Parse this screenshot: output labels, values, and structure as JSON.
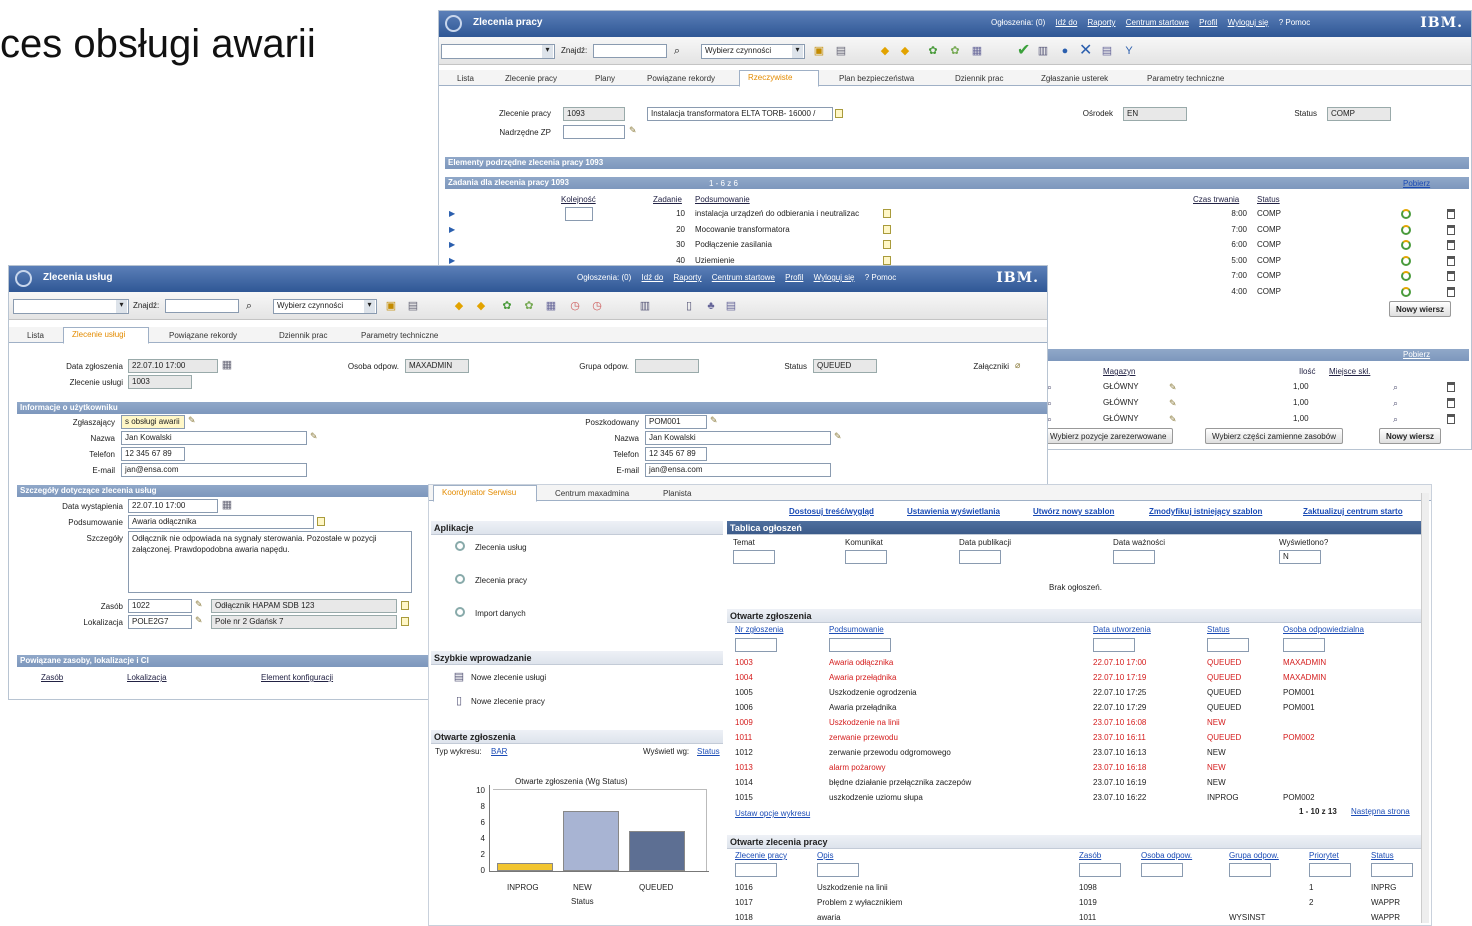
{
  "slide": {
    "title": "ces obsługi awarii"
  },
  "colors": {
    "titlebar": "#3a629f",
    "section": "#8aa3c6",
    "accent": "#e38b00",
    "red": "#d41c1c",
    "link": "#1a4bb5"
  },
  "back": {
    "app_title": "Zlecenia pracy",
    "nav": [
      "Ogłoszenia: (0)",
      "Idź do",
      "Raporty",
      "Centrum startowe",
      "Profil",
      "Wyloguj się",
      "? Pomoc"
    ],
    "logo": "IBM.",
    "find_label": "Znajdź:",
    "action_select": "Wybierz czynności",
    "tabs": [
      "Lista",
      "Zlecenie pracy",
      "Plany",
      "Powiązane rekordy",
      "Rzeczywiste",
      "Plan bezpieczeństwa",
      "Dziennik prac",
      "Zgłaszanie usterek",
      "Parametry techniczne"
    ],
    "active_tab": "Rzeczywiste",
    "wo_label": "Zlecenie pracy",
    "wo_value": "1093",
    "wo_desc": "Instalacja transformatora ELTA TORB- 16000 /",
    "parent_label": "Nadrzędne ZP",
    "site_label": "Ośrodek",
    "site_value": "EN",
    "status_label": "Status",
    "status_value": "COMP",
    "child_section": "Elementy podrzędne zlecenia pracy 1093",
    "tasks_section": "Zadania dla zlecenia pracy 1093",
    "tasks_pager": "1 - 6 z 6",
    "tasks_filter": "Filtr",
    "download": "Pobierz",
    "task_headers": [
      "Kolejność",
      "Zadanie",
      "Podsumowanie",
      "Czas trwania",
      "Status"
    ],
    "tasks": [
      {
        "task": "10",
        "summary": "instalacja urządzeń do odbierania i neutralizac",
        "duration": "8:00",
        "status": "COMP"
      },
      {
        "task": "20",
        "summary": "Mocowanie transformatora",
        "duration": "7:00",
        "status": "COMP"
      },
      {
        "task": "30",
        "summary": "Podłączenie zasilania",
        "duration": "6:00",
        "status": "COMP"
      },
      {
        "task": "40",
        "summary": "Uziemienie",
        "duration": "5:00",
        "status": "COMP"
      },
      {
        "task": "",
        "summary": "",
        "duration": "7:00",
        "status": "COMP"
      },
      {
        "task": "",
        "summary": "",
        "duration": "4:00",
        "status": "COMP"
      }
    ],
    "new_row": "Nowy wiersz",
    "materials_headers": [
      "Magazyn",
      "Ilość",
      "Miejsce skł."
    ],
    "materials": [
      {
        "store": "GŁÓWNY",
        "qty": "1,00"
      },
      {
        "store": "GŁÓWNY",
        "qty": "1,00"
      },
      {
        "store": "GŁÓWNY",
        "qty": "1,00"
      }
    ],
    "btn_reserved": "Wybierz pozycje zarezerwowane",
    "btn_spare": "Wybierz części zamienne zasobów",
    "btn_new_row": "Nowy wiersz"
  },
  "front": {
    "app_title": "Zlecenia usług",
    "nav": [
      "Ogłoszenia: (0)",
      "Idź do",
      "Raporty",
      "Centrum startowe",
      "Profil",
      "Wyloguj się",
      "? Pomoc"
    ],
    "logo": "IBM.",
    "find_label": "Znajdź:",
    "action_select": "Wybierz czynności",
    "tabs": [
      "Lista",
      "Zlecenie usługi",
      "Powiązane rekordy",
      "Dziennik prac",
      "Parametry techniczne"
    ],
    "active_tab": "Zlecenie usługi",
    "report_date_label": "Data zgłoszenia",
    "report_date": "22.07.10 17:00",
    "sr_label": "Zlecenie usługi",
    "sr_value": "1003",
    "owner_label": "Osoba odpow.",
    "owner_value": "MAXADMIN",
    "group_label": "Grupa odpow.",
    "status_label": "Status",
    "status_value": "QUEUED",
    "attach_label": "Załączniki",
    "user_section": "Informacje o użytkowniku",
    "reporter_label": "Zgłaszający",
    "reporter_value": "s obsługi awarii",
    "name_label": "Nazwa",
    "name_value": "Jan Kowalski",
    "phone_label": "Telefon",
    "phone_value": "12 345 67 89",
    "email_label": "E-mail",
    "email_value": "jan@ensa.com",
    "affected_label": "Poszkodowany",
    "affected_value": "POM001",
    "a_name_value": "Jan Kowalski",
    "a_phone_value": "12 345 67 89",
    "a_email_value": "jan@ensa.com",
    "details_section": "Szczegóły dotyczące zlecenia usług",
    "occ_label": "Data wystąpienia",
    "occ_value": "22.07.10 17:00",
    "summary_label": "Podsumowanie",
    "summary_value": "Awaria odłącznika",
    "details_label": "Szczegóły",
    "details_value": "Odłącznik nie odpowiada na sygnały sterowania. Pozostałe w pozycji załączonej. Prawdopodobna awaria napędu.",
    "asset_label": "Zasób",
    "asset_value": "1022",
    "asset_desc": "Odłącznik HAPAM SDB 123",
    "loc_label": "Lokalizacja",
    "loc_value": "POLE2G7",
    "loc_desc": "Pole nr 2 Gdańsk 7",
    "related_section": "Powiązane zasoby, lokalizacje i CI",
    "related_headers": [
      "Zasób",
      "Lokalizacja",
      "Element konfiguracji"
    ]
  },
  "start": {
    "tabs": [
      "Koordynator Serwisu",
      "Centrum maxadmina",
      "Planista"
    ],
    "active_tab": "Koordynator Serwisu",
    "links": [
      "Dostosuj treść/wygląd",
      "Ustawienia wyświetlania",
      "Utwórz nowy szablon",
      "Zmodyfikuj istniejący szablon",
      "Zaktualizuj centrum starto"
    ],
    "apps_title": "Aplikacje",
    "apps": [
      "Zlecenia usług",
      "Zlecenia pracy",
      "Import danych"
    ],
    "quick_title": "Szybkie wprowadzanie",
    "quick": [
      "Nowe zlecenie usługi",
      "Nowe zlecenie pracy"
    ],
    "board_title": "Tablica ogłoszeń",
    "board_headers": [
      "Temat",
      "Komunikat",
      "Data publikacji",
      "Data ważności",
      "Wyświetlono?"
    ],
    "board_filter_value": "N",
    "board_empty": "Brak ogłoszeń.",
    "open_title": "Otwarte zgłoszenia",
    "open_headers": [
      "Nr zgłoszenia",
      "Podsumowanie",
      "Data utworzenia",
      "Status",
      "Osoba odpowiedzialna"
    ],
    "open_rows": [
      {
        "id": "1003",
        "summary": "Awaria odłącznika",
        "date": "22.07.10 17:00",
        "status": "QUEUED",
        "owner": "MAXADMIN",
        "red": true
      },
      {
        "id": "1004",
        "summary": "Awaria przełądnika",
        "date": "22.07.10 17:19",
        "status": "QUEUED",
        "owner": "MAXADMIN",
        "red": true
      },
      {
        "id": "1005",
        "summary": "Uszkodzenie ogrodzenia",
        "date": "22.07.10 17:25",
        "status": "QUEUED",
        "owner": "POM001",
        "red": false
      },
      {
        "id": "1006",
        "summary": "Awaria przełądnika",
        "date": "22.07.10 17:29",
        "status": "QUEUED",
        "owner": "POM001",
        "red": false
      },
      {
        "id": "1009",
        "summary": "Uszkodzenie na linii",
        "date": "23.07.10 16:08",
        "status": "NEW",
        "owner": "",
        "red": true
      },
      {
        "id": "1011",
        "summary": "zerwanie przewodu",
        "date": "23.07.10 16:11",
        "status": "QUEUED",
        "owner": "POM002",
        "red": true
      },
      {
        "id": "1012",
        "summary": "zerwanie przewodu odgromowego",
        "date": "23.07.10 16:13",
        "status": "NEW",
        "owner": "",
        "red": false
      },
      {
        "id": "1013",
        "summary": "alarm pożarowy",
        "date": "23.07.10 16:18",
        "status": "NEW",
        "owner": "",
        "red": true
      },
      {
        "id": "1014",
        "summary": "błędne działanie przełącznika zaczepów",
        "date": "23.07.10 16:19",
        "status": "NEW",
        "owner": "",
        "red": false
      },
      {
        "id": "1015",
        "summary": "uszkodzenie uziomu słupa",
        "date": "23.07.10 16:22",
        "status": "INPROG",
        "owner": "POM002",
        "red": false
      }
    ],
    "chart_options": "Ustaw opcje wykresu",
    "pager": "1 - 10 z 13",
    "next_page": "Następna strona",
    "chart_portlet_title": "Otwarte zgłoszenia",
    "chart_type_label": "Typ wykresu:",
    "chart_type_value": "BAR",
    "show_by_label": "Wyświetl wg:",
    "show_by_value": "Status",
    "wo_title": "Otwarte zlecenia pracy",
    "wo_headers": [
      "Zlecenie pracy",
      "Opis",
      "Zasób",
      "Osoba odpow.",
      "Grupa odpow.",
      "Priorytet",
      "Status"
    ],
    "wo_rows": [
      {
        "id": "1016",
        "desc": "Uszkodzenie na linii",
        "asset": "1098",
        "person": "",
        "group": "",
        "prio": "1",
        "status": "INPRG"
      },
      {
        "id": "1017",
        "desc": "Problem z wyłacznikiem",
        "asset": "1019",
        "person": "",
        "group": "",
        "prio": "2",
        "status": "WAPPR"
      },
      {
        "id": "1018",
        "desc": "awaria",
        "asset": "1011",
        "person": "",
        "group": "WYSINST",
        "prio": "",
        "status": "WAPPR"
      }
    ]
  },
  "chart_data": {
    "type": "bar",
    "title": "Otwarte zgłoszenia (Wg Status)",
    "xlabel": "Status",
    "ylabel": "",
    "categories": [
      "INPROG",
      "NEW",
      "QUEUED"
    ],
    "values": [
      1,
      7.5,
      5
    ],
    "ylim": [
      0,
      10
    ],
    "yticks": [
      "0",
      "2",
      "4",
      "6",
      "8",
      "10"
    ],
    "colors": [
      "#f2c530",
      "#a8b4d3",
      "#5d6f93"
    ],
    "grid": false,
    "legend": "none"
  }
}
